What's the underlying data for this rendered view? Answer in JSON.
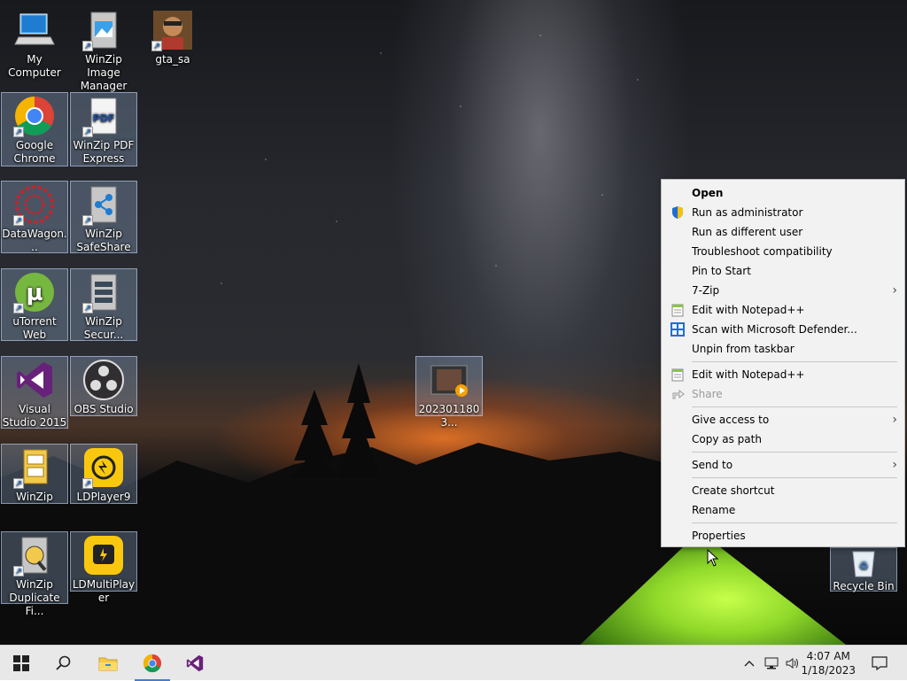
{
  "desktop": {
    "icons": [
      {
        "label": "My Computer",
        "icon": "computer-icon"
      },
      {
        "label": "WinZip Image Manager",
        "icon": "winzip-image-icon"
      },
      {
        "label": "gta_sa",
        "icon": "gta-icon"
      },
      {
        "label": "Google Chrome",
        "icon": "chrome-icon"
      },
      {
        "label": "WinZip PDF Express",
        "icon": "winzip-pdf-icon"
      },
      {
        "label": "DataWagon...",
        "icon": "datawagon-icon"
      },
      {
        "label": "WinZip SafeShare",
        "icon": "winzip-safeshare-icon"
      },
      {
        "label": "uTorrent Web",
        "icon": "utorrent-icon"
      },
      {
        "label": "WinZip Secur...",
        "icon": "winzip-secure-icon"
      },
      {
        "label": "Visual Studio 2015",
        "icon": "visual-studio-icon"
      },
      {
        "label": "OBS Studio",
        "icon": "obs-icon"
      },
      {
        "label": "WinZip",
        "icon": "winzip-icon"
      },
      {
        "label": "LDPlayer9",
        "icon": "ldplayer-icon"
      },
      {
        "label": "WinZip Duplicate Fi...",
        "icon": "winzip-duplicate-icon"
      },
      {
        "label": "LDMultiPlayer",
        "icon": "ldmultiplayer-icon"
      },
      {
        "label": "2023011803...",
        "icon": "video-file-icon"
      },
      {
        "label": "Recycle Bin",
        "icon": "recycle-bin-icon"
      }
    ]
  },
  "context_menu": {
    "items": [
      {
        "label": "Open",
        "bold": true
      },
      {
        "label": "Run as administrator",
        "icon": "uac-shield-icon"
      },
      {
        "label": "Run as different user"
      },
      {
        "label": "Troubleshoot compatibility"
      },
      {
        "label": "Pin to Start"
      },
      {
        "label": "7-Zip",
        "submenu": true
      },
      {
        "label": "Edit with Notepad++",
        "icon": "notepadpp-icon"
      },
      {
        "label": "Scan with Microsoft Defender...",
        "icon": "defender-icon"
      },
      {
        "label": "Unpin from taskbar"
      },
      {
        "label": "Edit with Notepad++",
        "icon": "notepadpp-icon"
      },
      {
        "label": "Share",
        "icon": "share-icon",
        "disabled": true
      },
      {
        "label": "Give access to",
        "submenu": true
      },
      {
        "label": "Copy as path"
      },
      {
        "label": "Send to",
        "submenu": true
      },
      {
        "label": "Create shortcut"
      },
      {
        "label": "Rename"
      },
      {
        "label": "Properties"
      }
    ]
  },
  "taskbar": {
    "pinned": [
      "windows-start-icon",
      "search-icon",
      "file-explorer-icon",
      "chrome-icon",
      "visual-studio-icon"
    ],
    "tray": {
      "time": "4:07 AM",
      "date": "1/18/2023",
      "icons": [
        "chevron-up-icon",
        "network-icon",
        "volume-icon",
        "notifications-icon"
      ]
    }
  },
  "colors": {
    "taskbar_bg": "#e8e8e8",
    "menu_bg": "#f2f2f2",
    "accent": "#4a7cc9"
  }
}
